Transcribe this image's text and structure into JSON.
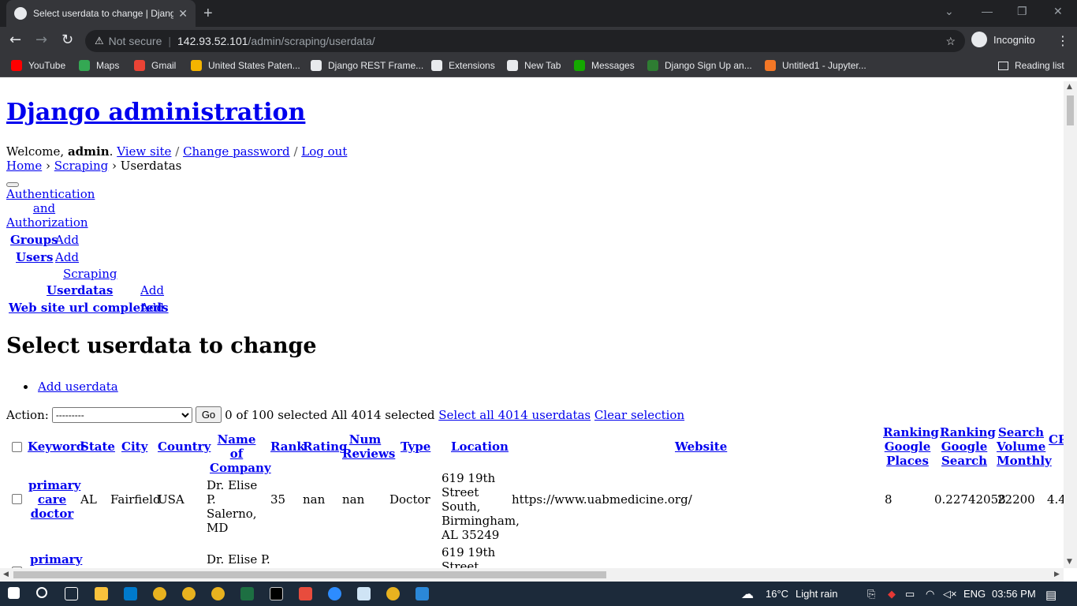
{
  "browser": {
    "tab_title": "Select userdata to change | Django",
    "new_tab": "+",
    "not_secure": "Not secure",
    "url_host": "142.93.52.101",
    "url_path": "/admin/scraping/userdata/",
    "profile": "Incognito",
    "bookmarks": [
      {
        "label": "YouTube",
        "color": "#ff0000"
      },
      {
        "label": "Maps",
        "color": "#34a853"
      },
      {
        "label": "Gmail",
        "color": "#ea4335"
      },
      {
        "label": "United States Paten...",
        "color": "#f4b400"
      },
      {
        "label": "Django REST Frame...",
        "color": "#e8eaed"
      },
      {
        "label": "Extensions",
        "color": "#e8eaed"
      },
      {
        "label": "New Tab",
        "color": "#e8eaed"
      },
      {
        "label": "Messages",
        "color": "#14a800"
      },
      {
        "label": "Django Sign Up an...",
        "color": "#2e7d32"
      },
      {
        "label": "Untitled1 - Jupyter...",
        "color": "#f37726"
      }
    ],
    "reading_list": "Reading list"
  },
  "header": {
    "site_name": "Django administration",
    "welcome": "Welcome,",
    "username": "admin",
    "view_site": "View site",
    "change_password": "Change password",
    "log_out": "Log out"
  },
  "breadcrumbs": {
    "home": "Home",
    "app": "Scraping",
    "current": "Userdatas"
  },
  "nav": {
    "auth_app": "Authentication and Authorization",
    "auth_app_lines": [
      "Authentication",
      "and",
      "Authorization"
    ],
    "groups": "Groups",
    "users": "Users",
    "scraping_app": "Scraping",
    "userdatas": "Userdatas",
    "website_urls": "Web site url completeds",
    "add": "Add"
  },
  "content": {
    "title": "Select userdata to change",
    "add_link": "Add userdata",
    "action_label": "Action:",
    "action_selected": "---------",
    "go": "Go",
    "counter": "0 of 100 selected",
    "all_selected": "All 4014 selected",
    "select_all": "Select all 4014 userdatas",
    "clear_selection": "Clear selection"
  },
  "table": {
    "headers": [
      "Keyword",
      "State",
      "City",
      "Country",
      "Name of Company",
      "Rank",
      "Rating",
      "Num Reviews",
      "Type",
      "Location",
      "Website",
      "Ranking Google Places",
      "Ranking Google Search",
      "Search Volume Monthly",
      "CP..."
    ],
    "rows": [
      {
        "keyword": "primary care doctor",
        "state": "AL",
        "city": "Fairfield",
        "country": "USA",
        "company": "Dr. Elise P. Salerno, MD",
        "rank": "35",
        "rating": "nan",
        "num_reviews": "nan",
        "type": "Doctor",
        "location": "619 19th Street South, Birmingham, AL 35249",
        "website": "https://www.uabmedicine.org/",
        "ranking_places": "8",
        "ranking_search": "0.22742058",
        "search_volume": "22200",
        "cpc": "4.4"
      },
      {
        "keyword": "primary",
        "company": "Dr. Elise P.",
        "location": "619 19th Street South"
      }
    ]
  },
  "taskbar": {
    "weather_temp": "16°C",
    "weather_text": "Light rain",
    "language": "ENG",
    "time": "03:56 PM"
  }
}
